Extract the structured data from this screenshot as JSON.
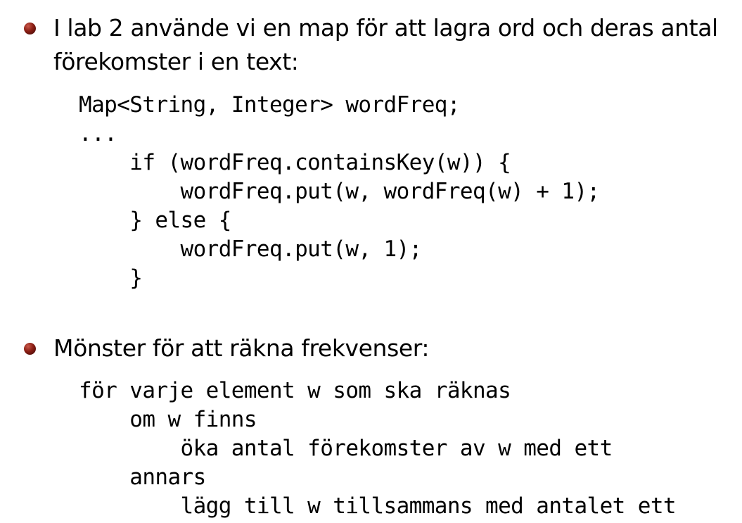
{
  "section1": {
    "bullet_line1": "I lab 2 använde vi en map för att lagra ord och deras antal",
    "bullet_line2": "förekomster i en text:",
    "code_lines": [
      "Map<String, Integer> wordFreq;",
      "...",
      "    if (wordFreq.containsKey(w)) {",
      "        wordFreq.put(w, wordFreq(w) + 1);",
      "    } else {",
      "        wordFreq.put(w, 1);",
      "    }"
    ]
  },
  "section2": {
    "bullet_line1": "Mönster för att räkna frekvenser:",
    "code_lines": [
      "för varje element w som ska räknas",
      "    om w finns",
      "        öka antal förekomster av w med ett",
      "    annars",
      "        lägg till w tillsammans med antalet ett"
    ]
  },
  "colors": {
    "bullet": "#8a1e14",
    "text": "#000000",
    "background": "#ffffff"
  }
}
